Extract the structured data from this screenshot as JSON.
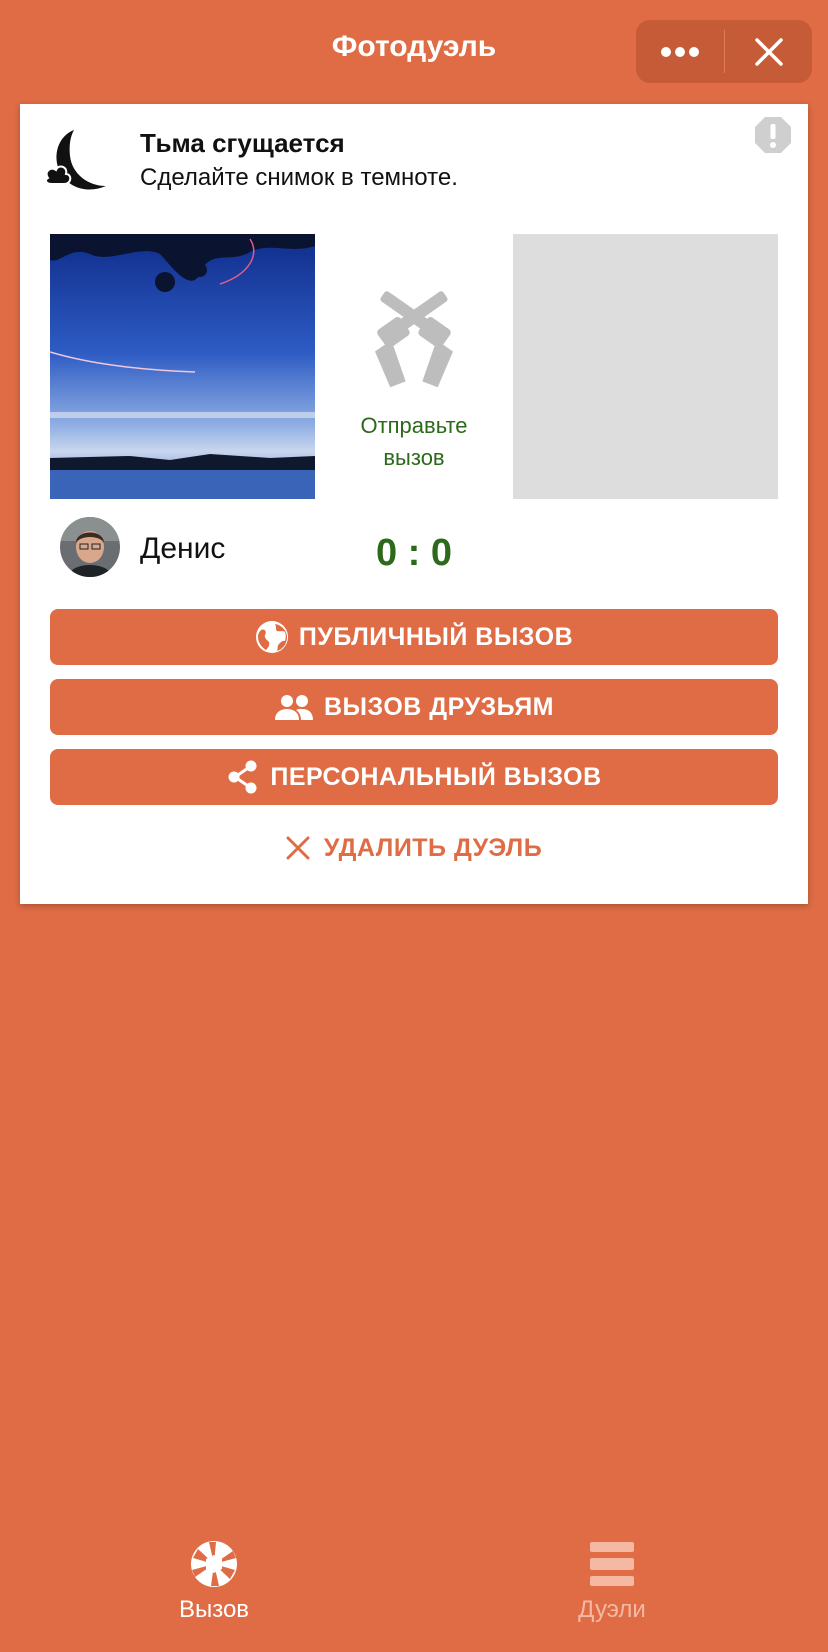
{
  "header": {
    "title": "Фотодуэль",
    "more_icon": "ellipsis-icon",
    "close_icon": "close-icon"
  },
  "challenge": {
    "icon": "moon-icon",
    "title": "Тьма сгущается",
    "description": "Сделайте снимок в темноте.",
    "report_icon": "report-icon"
  },
  "duel": {
    "crossed_guns_icon": "crossed-revolvers-icon",
    "send_challenge_line1": "Отправьте",
    "send_challenge_line2": "вызов",
    "player_name": "Денис",
    "score": "0 : 0"
  },
  "actions": {
    "public": "ПУБЛИЧНЫЙ ВЫЗОВ",
    "friends": "ВЫЗОВ ДРУЗЬЯМ",
    "personal": "ПЕРСОНАЛЬНЫЙ ВЫЗОВ",
    "delete": "УДАЛИТЬ ДУЭЛЬ"
  },
  "tabs": [
    {
      "label": "Вызов",
      "icon": "camera-aperture-icon",
      "active": true
    },
    {
      "label": "Дуэли",
      "icon": "stack-icon",
      "active": false
    }
  ],
  "colors": {
    "accent": "#DF6C45",
    "score_green": "#2C6A1A",
    "placeholder_gray": "#DDDDDD"
  }
}
